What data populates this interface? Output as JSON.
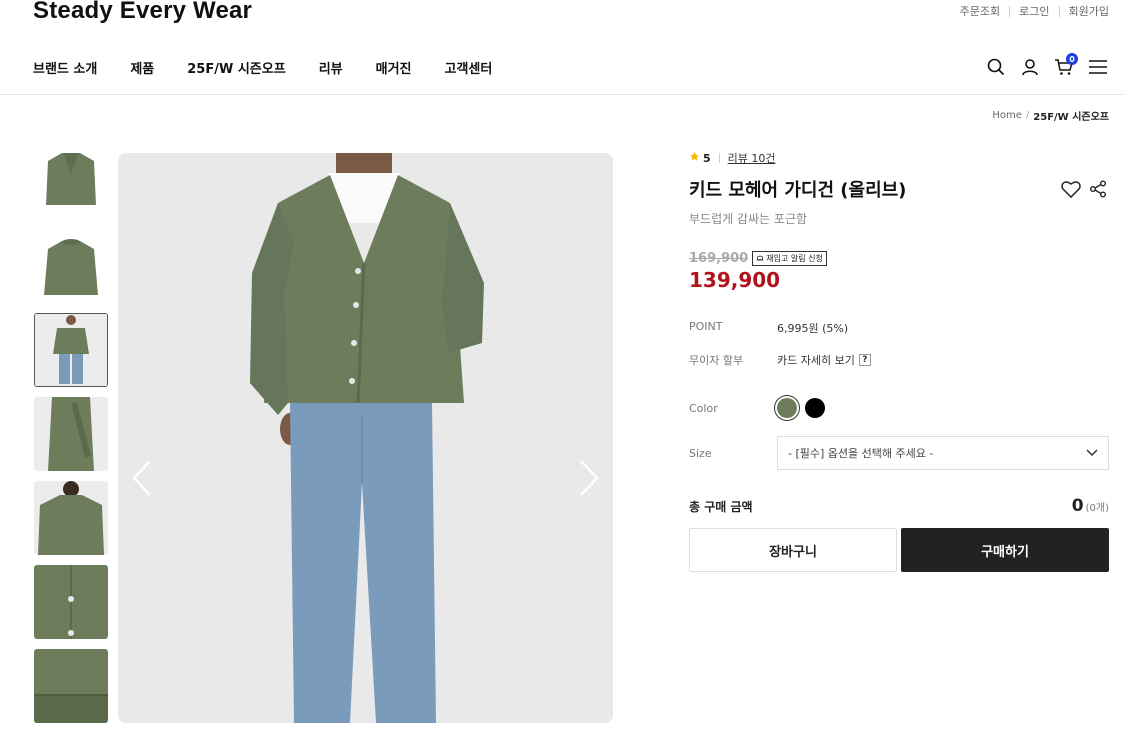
{
  "header": {
    "logo": "Steady Every Wear",
    "util_links": [
      "주문조회",
      "로그인",
      "회원가입"
    ],
    "nav": [
      "브랜드 소개",
      "제품",
      "25F/W 시즌오프",
      "리뷰",
      "매거진",
      "고객센터"
    ],
    "cart_count": "0",
    "icons": [
      "search-icon",
      "user-icon",
      "cart-icon",
      "menu-icon"
    ]
  },
  "breadcrumb": {
    "home": "Home",
    "separator": "/",
    "current": "25F/W 시즌오프"
  },
  "gallery": {
    "thumbnail_count": 7,
    "selected_index": 2
  },
  "product": {
    "rating": "5",
    "reviews": "리뷰 10건",
    "name": "키드 모헤어 가디건 (올리브)",
    "description": "부드럽게 감싸는 포근함",
    "original_price": "169,900",
    "restock_label": "재입고 알림 신청",
    "price": "139,900",
    "point_label": "POINT",
    "point_value": "6,995원 (5%)",
    "installment_label": "무이자 할부",
    "installment_value": "카드 자세히 보기",
    "help_mark": "?",
    "color_label": "Color",
    "colors": [
      "#6d7d5c",
      "#000000"
    ],
    "size_label": "Size",
    "size_placeholder": "- [필수] 옵션을 선택해 주세요 -",
    "total_label": "총 구매 금액",
    "total_amount": "0",
    "total_count": "(0개)",
    "cart_button": "장바구니",
    "buy_button": "구매하기"
  },
  "colors": {
    "sale_price": "#b1121c",
    "accent": "#1a3fdc",
    "star": "#f5b400",
    "garment": "#6d7d5c"
  }
}
